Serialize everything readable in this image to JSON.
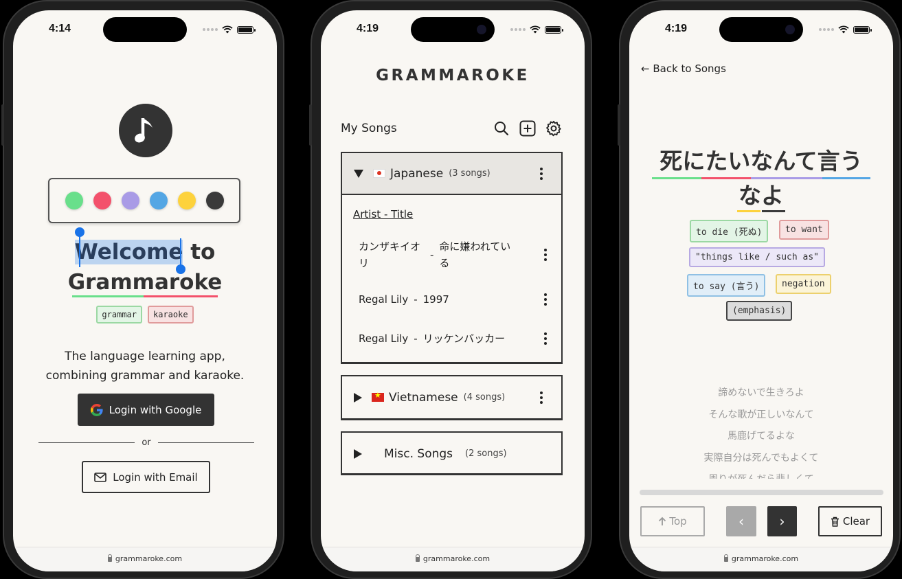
{
  "status": {
    "phone1_time": "4:14",
    "phone2_time": "4:19",
    "phone3_time": "4:19"
  },
  "url": "grammaroke.com",
  "colors": {
    "green": "#69df8b",
    "red": "#f3516b",
    "purple": "#a99be6",
    "blue": "#54a6e4",
    "yellow": "#fdd23c",
    "dark": "#3a3a3a"
  },
  "login": {
    "logo_icon": "music-note-icon",
    "welcome_selected": "Welcome",
    "welcome_rest": " to",
    "app_name": "Grammaroke",
    "chip_grammar": "grammar",
    "chip_karaoke": "karaoke",
    "tagline_1": "The language learning app,",
    "tagline_2": "combining grammar and karaoke.",
    "google_button": "Login with Google",
    "divider": "or",
    "email_button": "Login with Email"
  },
  "songs": {
    "brand": "GRAMMAROKE",
    "header_title": "My Songs",
    "groups": [
      {
        "name": "Japanese",
        "count": "(3 songs)",
        "expanded": true
      },
      {
        "name": "Vietnamese",
        "count": "(4 songs)",
        "expanded": false
      },
      {
        "name": "Misc. Songs",
        "count": "(2 songs)",
        "expanded": false
      }
    ],
    "column_header": "Artist - Title",
    "items": [
      {
        "artist": "カンザキイオ\nリ",
        "separator": "-",
        "title": "命に嫌われてい\nる"
      },
      {
        "artist": "Regal Lily",
        "separator": "-",
        "title": "1997"
      },
      {
        "artist": "Regal Lily",
        "separator": "-",
        "title": "リッケンバッカー"
      }
    ]
  },
  "lyrics": {
    "back_link": "← Back to Songs",
    "title_line1": "死にたいなんて言う",
    "title_line2": "なよ",
    "chips": {
      "to_die": "to die (死ぬ)",
      "to_want": "to want",
      "things_like": "\"things like / such as\"",
      "to_say": "to say (言う)",
      "negation": "negation",
      "emphasis": "(emphasis)"
    },
    "lines": [
      "諦めないで生きろよ",
      "そんな歌が正しいなんて",
      "馬鹿げてるよな",
      "実際自分は死んでもよくて",
      "周りが死んだら悲しくて"
    ],
    "buttons": {
      "top": "Top",
      "prev": "‹",
      "next": "›",
      "clear": "Clear"
    }
  }
}
